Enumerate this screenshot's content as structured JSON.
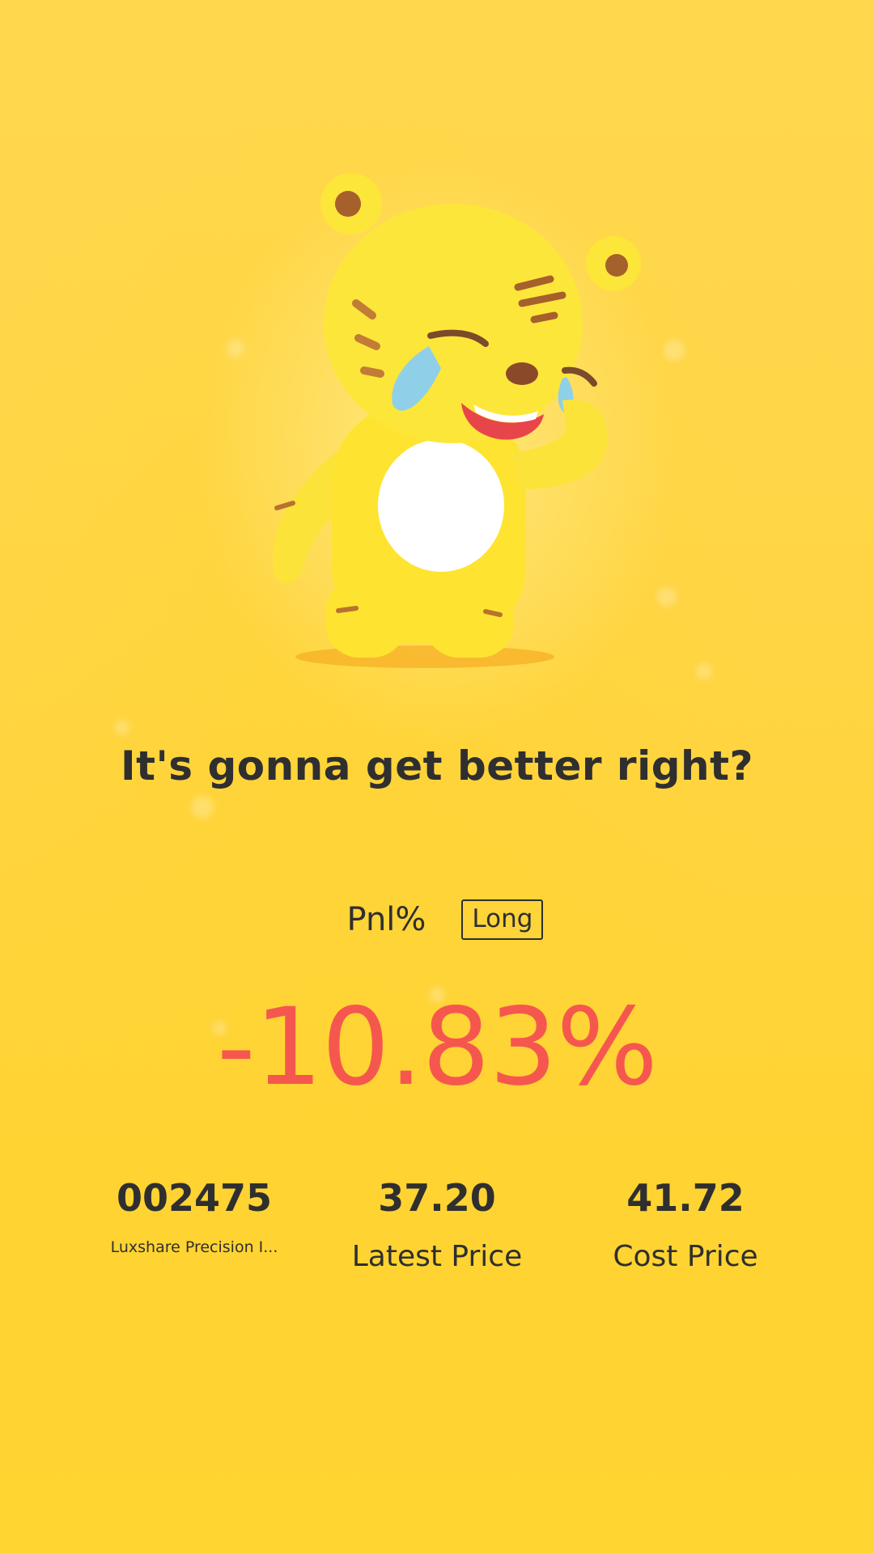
{
  "headline": "It's gonna get better right?",
  "pnl": {
    "label": "Pnl%",
    "direction": "Long",
    "value": "-10.83%"
  },
  "stock": {
    "code": "002475",
    "name": "Luxshare Precision I..."
  },
  "latest_price": {
    "value": "37.20",
    "label": "Latest Price"
  },
  "cost_price": {
    "value": "41.72",
    "label": "Cost Price"
  },
  "colors": {
    "background": "#ffd545",
    "loss": "#f5574f",
    "text": "#2f2f2f"
  },
  "icons": {
    "mascot": "crying-tiger-mascot"
  }
}
